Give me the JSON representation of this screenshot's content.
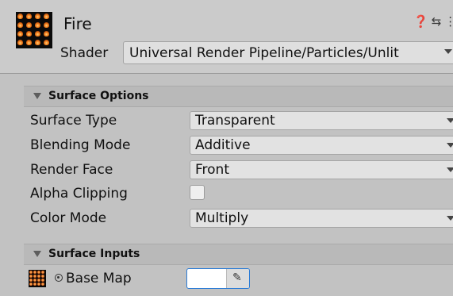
{
  "material": {
    "name": "Fire",
    "thumbnail_icon": "fire-particle-texture",
    "header_icons": "❓ ⇆ ⋮",
    "shader_label": "Shader",
    "shader_value": "Universal Render Pipeline/Particles/Unlit"
  },
  "surface_options": {
    "title": "Surface Options",
    "rows": [
      {
        "label": "Surface Type",
        "value": "Transparent"
      },
      {
        "label": "Blending Mode",
        "value": "Additive"
      },
      {
        "label": "Render Face",
        "value": "Front"
      },
      {
        "label": "Alpha Clipping",
        "checked": false
      },
      {
        "label": "Color Mode",
        "value": "Multiply"
      }
    ]
  },
  "surface_inputs": {
    "title": "Surface Inputs",
    "base_map_label": "Base Map",
    "base_map_color": "#ffffff"
  },
  "colors": {
    "header_bg": "#cbcbcb",
    "body_bg": "#c2c2c2",
    "section_bg": "#b9b9b9",
    "focus_outline": "#2a7bd6"
  }
}
